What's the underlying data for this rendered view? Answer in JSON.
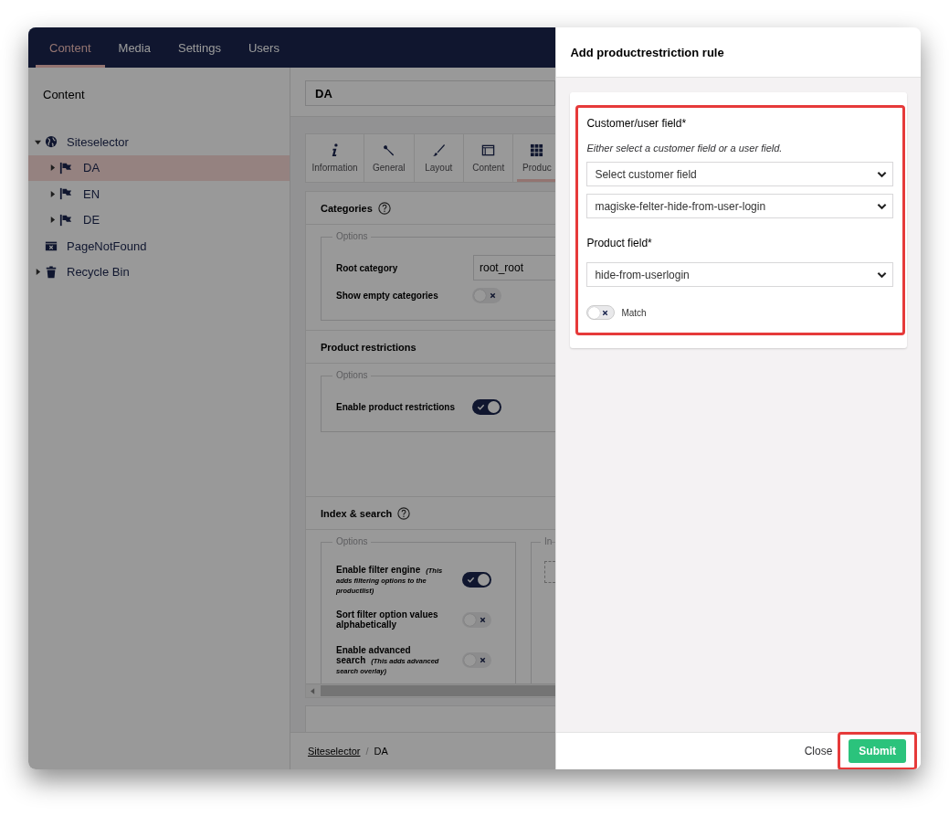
{
  "nav": {
    "tabs": [
      {
        "label": "Content",
        "selected": true
      },
      {
        "label": "Media",
        "selected": false
      },
      {
        "label": "Settings",
        "selected": false
      },
      {
        "label": "Users",
        "selected": false
      }
    ]
  },
  "sidebar": {
    "title": "Content",
    "tree": [
      {
        "label": "Siteselector",
        "expandable": true,
        "expanded": true,
        "selected": false,
        "children": [
          {
            "label": "DA",
            "expandable": true,
            "expanded": false,
            "selected": true
          },
          {
            "label": "EN",
            "expandable": true,
            "expanded": false,
            "selected": false
          },
          {
            "label": "DE",
            "expandable": true,
            "expanded": false,
            "selected": false
          }
        ]
      },
      {
        "label": "PageNotFound",
        "expandable": false,
        "expanded": false,
        "selected": false
      },
      {
        "label": "Recycle Bin",
        "expandable": true,
        "expanded": false,
        "selected": false
      }
    ]
  },
  "editor": {
    "name": "DA",
    "tabs": [
      {
        "label": "Information",
        "selected": false
      },
      {
        "label": "General",
        "selected": false
      },
      {
        "label": "Layout",
        "selected": false
      },
      {
        "label": "Content",
        "selected": false
      },
      {
        "label": "Produc",
        "selected": true
      }
    ],
    "sections": [
      {
        "title": "Categories",
        "help": true,
        "fieldsets": [
          {
            "legend": "Options",
            "rows": [
              {
                "kind": "input",
                "label": "Root category",
                "value": "root_root"
              },
              {
                "kind": "toggle",
                "label": "Show empty categories",
                "on": false
              }
            ]
          }
        ]
      },
      {
        "title": "Product restrictions",
        "help": false,
        "fieldsets": [
          {
            "legend": "Options",
            "rows": [
              {
                "kind": "toggle",
                "label": "Enable product restrictions",
                "on": true
              }
            ]
          }
        ]
      },
      {
        "title": "Index & search",
        "help": true,
        "fieldsets": [
          {
            "legend": "Options",
            "rows": [
              {
                "kind": "toggle",
                "label": "Enable filter engine",
                "note": "(This adds filtering options to the productlist)",
                "on": true
              },
              {
                "kind": "toggle",
                "label": "Sort filter option values alphabetically",
                "on": false
              },
              {
                "kind": "toggle",
                "label": "Enable advanced search",
                "note": "(This adds advanced search overlay)",
                "on": false
              }
            ]
          },
          {
            "legend": "In"
          }
        ]
      }
    ]
  },
  "breadcrumb": {
    "separator": "/",
    "items": [
      {
        "label": "Siteselector",
        "link": true
      },
      {
        "label": "DA",
        "link": false
      }
    ]
  },
  "dialog": {
    "title": "Add productrestriction rule",
    "highlighted": true,
    "fields": [
      {
        "kind": "label",
        "text": "Customer/user field*"
      },
      {
        "kind": "hint",
        "text": "Either select a customer field or a user field."
      },
      {
        "kind": "select",
        "value": "Select customer field"
      },
      {
        "kind": "select",
        "value": "magiske-felter-hide-from-user-login"
      },
      {
        "kind": "label",
        "text": "Product field*"
      },
      {
        "kind": "select",
        "value": "hide-from-userlogin"
      },
      {
        "kind": "toggle",
        "text": "Match",
        "on": false
      }
    ],
    "close": "Close",
    "submit": {
      "label": "Submit",
      "highlighted": true
    }
  }
}
